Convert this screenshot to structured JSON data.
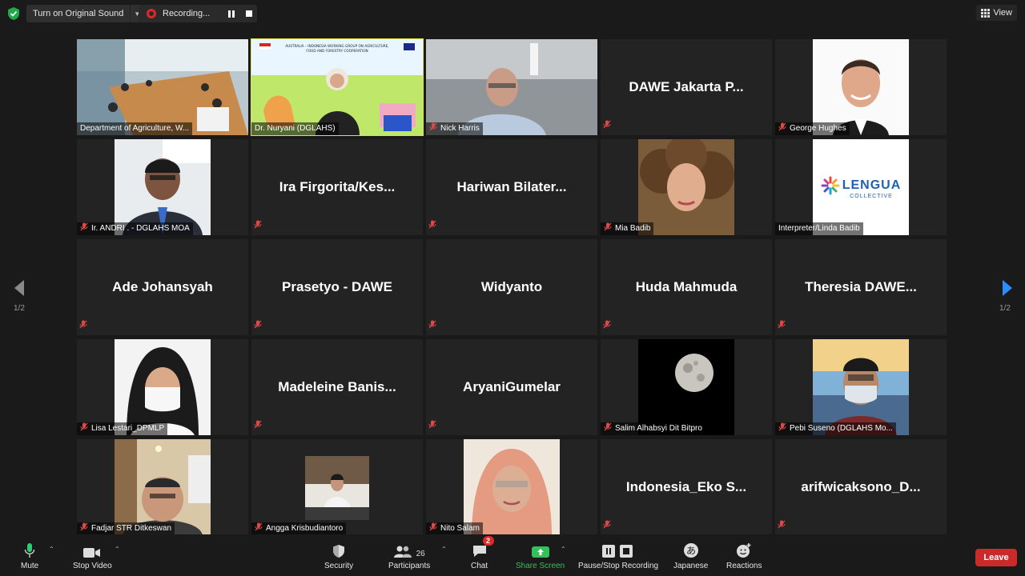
{
  "topbar": {
    "original_sound_label": "Turn on Original Sound",
    "recording_label": "Recording...",
    "view_label": "View"
  },
  "pagination": {
    "left_page": "1/2",
    "right_page": "1/2"
  },
  "tiles": [
    {
      "label": "Department of Agriculture, W...",
      "big": "",
      "video": "room",
      "muted": false
    },
    {
      "label": "Dr. Nuryani (DGLAHS)",
      "big": "",
      "video": "slide",
      "muted": false,
      "active": true,
      "slide_title": "AUSTRALIA – INDONESIA WORKING GROUP ON AGRICULTURE, FOOD AND FORESTRY COOPERATION"
    },
    {
      "label": "Nick Harris",
      "big": "",
      "video": "office",
      "muted": true
    },
    {
      "label": "",
      "big": "DAWE Jakarta P...",
      "video": "",
      "muted": true
    },
    {
      "label": "George Hughes",
      "big": "",
      "video": "portrait",
      "muted": true
    },
    {
      "label": "Ir. ANDRI . - DGLAHS MOA",
      "big": "",
      "video": "man-suit",
      "muted": true
    },
    {
      "label": "",
      "big": "Ira  Firgorita/Kes...",
      "video": "",
      "muted": true
    },
    {
      "label": "",
      "big": "Hariwan  Bilater...",
      "video": "",
      "muted": true
    },
    {
      "label": "Mia Badib",
      "big": "",
      "video": "woman-curly",
      "muted": true
    },
    {
      "label": "Interpreter/Linda Badib",
      "big": "",
      "video": "logo",
      "muted": false,
      "logo_text": "LENGUA",
      "logo_sub": "COLLECTIVE"
    },
    {
      "label": "",
      "big": "Ade Johansyah",
      "video": "",
      "muted": true
    },
    {
      "label": "",
      "big": "Prasetyo - DAWE",
      "video": "",
      "muted": true
    },
    {
      "label": "",
      "big": "Widyanto",
      "video": "",
      "muted": true
    },
    {
      "label": "",
      "big": "Huda Mahmuda",
      "video": "",
      "muted": true
    },
    {
      "label": "",
      "big": "Theresia  DAWE...",
      "video": "",
      "muted": true
    },
    {
      "label": "Lisa Lestari_DPMLP",
      "big": "",
      "video": "hijab-mask",
      "muted": true
    },
    {
      "label": "",
      "big": "Madeleine  Banis...",
      "video": "",
      "muted": true
    },
    {
      "label": "",
      "big": "AryaniGumelar",
      "video": "",
      "muted": true
    },
    {
      "label": "Salim Alhabsyi Dit Bitpro",
      "big": "",
      "video": "moon",
      "muted": true
    },
    {
      "label": "Pebi Suseno (DGLAHS Mo...",
      "big": "",
      "video": "man-mask",
      "muted": true
    },
    {
      "label": "Fadjar STR Ditkeswan",
      "big": "",
      "video": "man-room",
      "muted": true
    },
    {
      "label": "Angga Krisbudiantoro",
      "big": "",
      "video": "desk",
      "muted": true
    },
    {
      "label": "Nito Salam",
      "big": "",
      "video": "hijab-pink",
      "muted": true
    },
    {
      "label": "",
      "big": "Indonesia_Eko  S...",
      "video": "",
      "muted": true
    },
    {
      "label": "",
      "big": "arifwicaksono_D...",
      "video": "",
      "muted": true
    }
  ],
  "toolbar": {
    "mute": "Mute",
    "stop_video": "Stop Video",
    "security": "Security",
    "participants": "Participants",
    "participants_count": "26",
    "chat": "Chat",
    "chat_badge": "2",
    "share_screen": "Share Screen",
    "pause_stop_recording": "Pause/Stop Recording",
    "japanese": "Japanese",
    "reactions": "Reactions",
    "leave": "Leave",
    "accent": "#34c05a",
    "leave_color": "#c92b2b"
  }
}
